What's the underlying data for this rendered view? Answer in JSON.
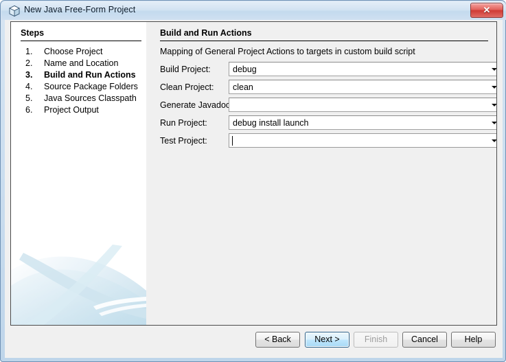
{
  "window": {
    "title": "New Java Free-Form Project",
    "icon": "java-cube-icon",
    "close_label": "✕"
  },
  "steps_panel": {
    "heading": "Steps",
    "items": [
      {
        "number": "1.",
        "label": "Choose Project",
        "current": false
      },
      {
        "number": "2.",
        "label": "Name and Location",
        "current": false
      },
      {
        "number": "3.",
        "label": "Build and Run Actions",
        "current": true
      },
      {
        "number": "4.",
        "label": "Source Package Folders",
        "current": false
      },
      {
        "number": "5.",
        "label": "Java Sources Classpath",
        "current": false
      },
      {
        "number": "6.",
        "label": "Project Output",
        "current": false
      }
    ]
  },
  "main": {
    "title": "Build and Run Actions",
    "description": "Mapping of General Project Actions to targets in custom build script",
    "fields": [
      {
        "label": "Build Project:",
        "value": "debug",
        "focused": false
      },
      {
        "label": "Clean Project:",
        "value": "clean",
        "focused": false
      },
      {
        "label": "Generate Javadoc:",
        "value": "",
        "focused": false
      },
      {
        "label": "Run Project:",
        "value": "debug install launch",
        "focused": false
      },
      {
        "label": "Test Project:",
        "value": "",
        "focused": true
      }
    ]
  },
  "buttons": {
    "back": "< Back",
    "next": "Next >",
    "finish": "Finish",
    "cancel": "Cancel",
    "help": "Help"
  },
  "colors": {
    "accent_blue": "#bee6fd",
    "default_button_border": "#2c628b",
    "title_bar": "#cfe0f1",
    "panel_background": "#f0f0f0",
    "steps_background": "#ffffff",
    "swoosh": "#cfe4ef"
  }
}
